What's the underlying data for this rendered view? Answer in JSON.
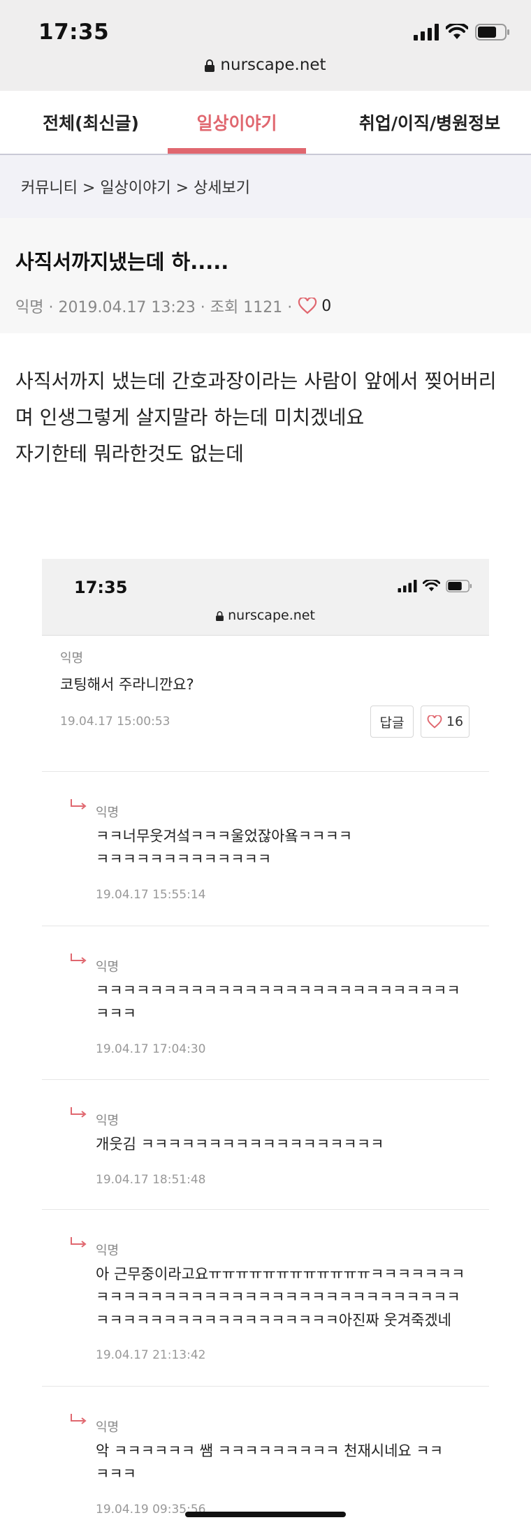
{
  "status": {
    "time": "17:35",
    "url": "nurscape.net"
  },
  "tabs": [
    {
      "label": "전체(최신글)"
    },
    {
      "label": "일상이야기"
    },
    {
      "label": "취업/이직/병원정보"
    }
  ],
  "breadcrumb": "커뮤니티 > 일상이야기 > 상세보기",
  "post": {
    "title": "사직서까지냈는데 하.....",
    "meta": "익명 · 2019.04.17 13:23 · 조회 1121 ·",
    "likes": "0",
    "body": [
      "사직서까지 냈는데 간호과장이라는 사람이 앞에서 찢어버리",
      "며 인생그렇게 살지말라 하는데 미치겠네요",
      "자기한테 뭐라한것도 없는데"
    ]
  },
  "screenshot": {
    "time": "17:35",
    "url": "nurscape.net",
    "comment": {
      "author": "익명",
      "text": "코팅해서 주라니깐요?",
      "date": "19.04.17 15:00:53",
      "reply_label": "답글",
      "likes": "16"
    },
    "replies": [
      {
        "author": "익명",
        "lines": [
          "ㅋㅋ너무웃겨섴ㅋㅋㅋ울었잖아욬ㅋㅋㅋㅋ",
          "ㅋㅋㅋㅋㅋㅋㅋㅋㅋㅋㅋㅋㅋ"
        ],
        "date": "19.04.17 15:55:14"
      },
      {
        "author": "익명",
        "lines": [
          "ㅋㅋㅋㅋㅋㅋㅋㅋㅋㅋㅋㅋㅋㅋㅋㅋㅋㅋㅋㅋㅋㅋㅋㅋㅋㅋㅋ",
          "ㅋㅋㅋ"
        ],
        "date": "19.04.17 17:04:30"
      },
      {
        "author": "익명",
        "lines": [
          "개웃김 ㅋㅋㅋㅋㅋㅋㅋㅋㅋㅋㅋㅋㅋㅋㅋㅋㅋㅋ"
        ],
        "date": "19.04.17 18:51:48"
      },
      {
        "author": "익명",
        "lines": [
          "아 근무중이라고요ㅠㅠㅠㅠㅠㅠㅠㅠㅠㅠㅠㅠㅋㅋㅋㅋㅋㅋㅋ",
          "ㅋㅋㅋㅋㅋㅋㅋㅋㅋㅋㅋㅋㅋㅋㅋㅋㅋㅋㅋㅋㅋㅋㅋㅋㅋㅋㅋ",
          "ㅋㅋㅋㅋㅋㅋㅋㅋㅋㅋㅋㅋㅋㅋㅋㅋㅋㅋ아진짜 웃겨죽겠네"
        ],
        "date": "19.04.17 21:13:42"
      },
      {
        "author": "익명",
        "lines": [
          "악 ㅋㅋㅋㅋㅋㅋ 쌤 ㅋㅋㅋㅋㅋㅋㅋㅋㅋ 천재시네요 ㅋㅋ",
          "ㅋㅋㅋ"
        ],
        "date": "19.04.19 09:35:56"
      }
    ]
  },
  "icons": [
    "signal-icon",
    "wifi-icon",
    "battery-icon",
    "lock-icon",
    "heart-icon",
    "reply-arrow-icon"
  ],
  "colors": {
    "accent": "#e0676f"
  }
}
